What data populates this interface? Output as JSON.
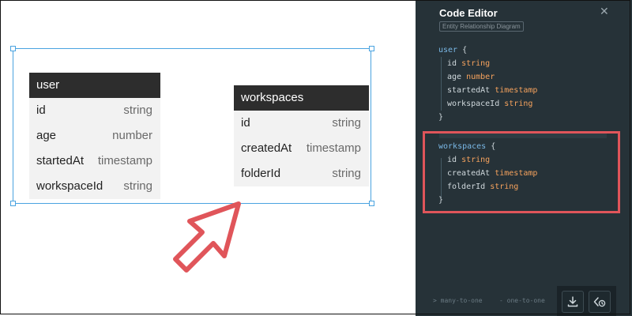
{
  "diagram": {
    "entities": [
      {
        "name": "user",
        "fields": [
          {
            "name": "id",
            "type": "string"
          },
          {
            "name": "age",
            "type": "number"
          },
          {
            "name": "startedAt",
            "type": "timestamp"
          },
          {
            "name": "workspaceId",
            "type": "string"
          }
        ]
      },
      {
        "name": "workspaces",
        "fields": [
          {
            "name": "id",
            "type": "string"
          },
          {
            "name": "createdAt",
            "type": "timestamp"
          },
          {
            "name": "folderId",
            "type": "string"
          }
        ]
      }
    ]
  },
  "editor": {
    "title": "Code Editor",
    "subtitle": "Entity Relationship Diagram",
    "close_icon": "close-icon",
    "code": {
      "user_name": "user",
      "user_open": "{",
      "user_f0_name": "id",
      "user_f0_type": "string",
      "user_f1_name": "age",
      "user_f1_type": "number",
      "user_f2_name": "startedAt",
      "user_f2_type": "timestamp",
      "user_f3_name": "workspaceId",
      "user_f3_type": "string",
      "user_close": "}",
      "ws_name": "workspaces",
      "ws_open": "{",
      "ws_f0_name": "id",
      "ws_f0_type": "string",
      "ws_f1_name": "createdAt",
      "ws_f1_type": "timestamp",
      "ws_f2_name": "folderId",
      "ws_f2_type": "string",
      "ws_close": "}"
    },
    "legend": {
      "many_to_one": "> many-to-one",
      "one_to_one": "- one-to-one"
    },
    "toolbar": {
      "download_icon": "download-icon",
      "code_icon": "code-icon"
    },
    "colors": {
      "panel_bg": "#263238",
      "entity_name": "#7ab8e6",
      "type": "#f5a25d",
      "highlight": "#e0555a",
      "selection": "#4aa3e0"
    }
  },
  "annotations": {
    "cursor_icon": "arrow-cursor-icon"
  }
}
